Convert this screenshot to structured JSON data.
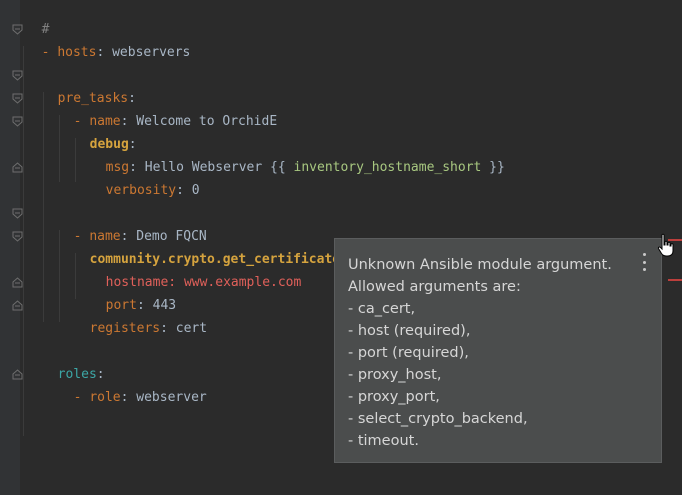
{
  "editor": {
    "lines": [
      {
        "id": "l0",
        "comment": "#"
      },
      {
        "id": "l1",
        "dash": "- ",
        "key": "hosts",
        "colon": ": ",
        "value": "webservers"
      },
      {
        "id": "l3",
        "key": "pre_tasks",
        "colon": ":"
      },
      {
        "id": "l4",
        "dash": "- ",
        "key": "name",
        "colon": ": ",
        "value": "Welcome to OrchidE"
      },
      {
        "id": "l5",
        "key": "debug",
        "colon": ":"
      },
      {
        "id": "l6",
        "key": "msg",
        "colon": ": ",
        "value_prefix": "Hello Webserver {{ ",
        "var": "inventory_hostname_short",
        "value_suffix": " }}"
      },
      {
        "id": "l7",
        "key": "verbosity",
        "colon": ": ",
        "value": "0"
      },
      {
        "id": "l9",
        "dash": "- ",
        "key": "name",
        "colon": ": ",
        "value": "Demo FQCN"
      },
      {
        "id": "l10",
        "key": "community.crypto.get_certificate",
        "colon": ":"
      },
      {
        "id": "l11",
        "key": "hostname",
        "colon": ": ",
        "value": "www.example.com"
      },
      {
        "id": "l12",
        "key": "port",
        "colon": ": ",
        "value": "443"
      },
      {
        "id": "l13",
        "key": "registers",
        "colon": ": ",
        "value": "cert"
      },
      {
        "id": "l15",
        "key": "roles",
        "colon": ":"
      },
      {
        "id": "l16",
        "dash": "- ",
        "key": "role",
        "colon": ": ",
        "value": "webserver"
      }
    ]
  },
  "tooltip": {
    "lines": [
      "Unknown Ansible module argument.",
      "Allowed arguments are:",
      "- ca_cert,",
      "- host (required),",
      "- port (required),",
      "- proxy_host,",
      "- proxy_port,",
      "- select_crypto_backend,",
      "- timeout."
    ],
    "menu_icon": "more-vertical-icon"
  },
  "colors": {
    "background": "#2b2b2b",
    "key": "#cc7832",
    "bold_key": "#d5a33e",
    "teal_key": "#3ca7a6",
    "error": "#e0605a",
    "string": "#a9b7c6",
    "tooltip_bg": "#4b4d4d"
  }
}
